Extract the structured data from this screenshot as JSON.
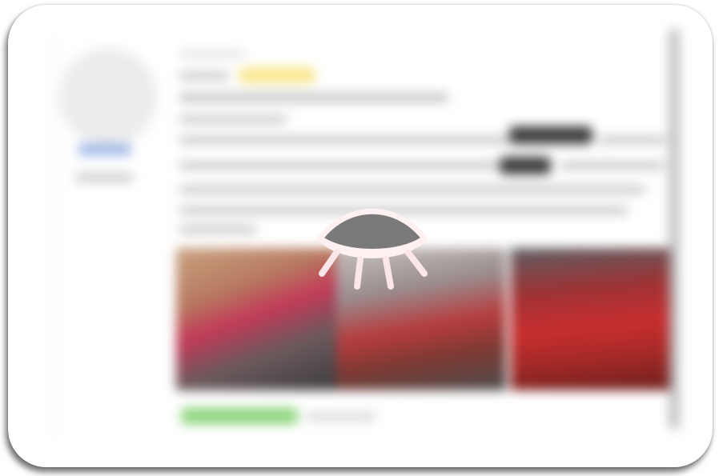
{
  "overlay": {
    "icon": "closed-eye-icon",
    "icon_fill": "#7a7a7a",
    "icon_outline": "#fff1f1",
    "icon_lashes": "#fbe7e9"
  },
  "card": {
    "background": "#ffffff",
    "state": "blurred"
  },
  "content_colors": {
    "accent_link": "#9bb5e6",
    "highlight_tag": "#f8e78e",
    "dark_tag": "#3b3b3b",
    "status_badge": "#8bd47a"
  }
}
